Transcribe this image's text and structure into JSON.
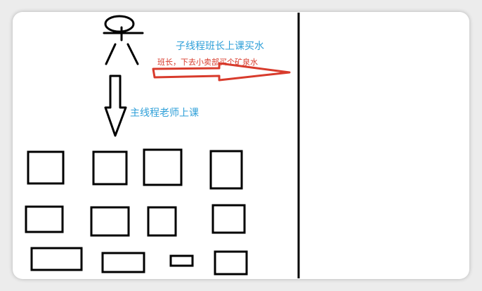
{
  "labels": {
    "main_thread": "主线程老师上课",
    "child_thread": "子线程班长上课买水",
    "child_note": "班长，下去小卖部买个矿泉水"
  },
  "colors": {
    "line": "#000000",
    "label_blue": "#2e9fd8",
    "arrow_red": "#d83b2c",
    "card_bg": "#ffffff"
  }
}
